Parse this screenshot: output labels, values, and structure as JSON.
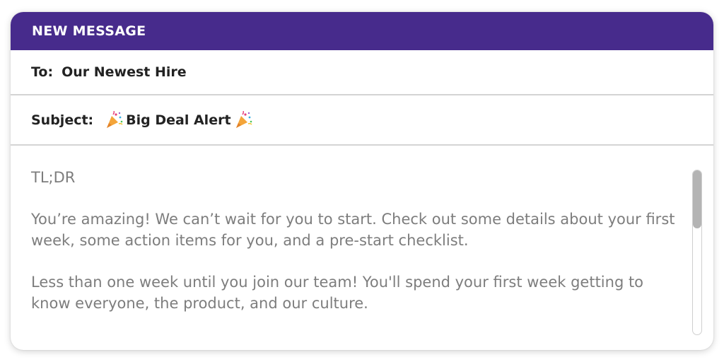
{
  "window": {
    "title": "NEW MESSAGE",
    "accent_color": "#472b8c"
  },
  "to": {
    "label": "To:",
    "value": "Our Newest Hire"
  },
  "subject": {
    "label": "Subject:",
    "emoji_left": "party-popper-icon",
    "value": "Big Deal Alert",
    "emoji_right": "party-popper-icon"
  },
  "body": {
    "paragraphs": [
      "TL;DR",
      "You’re amazing! We can’t wait for you to start. Check out some details about your first week, some action items for you, and a pre-start checklist.",
      "Less than one week until you join our team! You'll spend your first week getting to know everyone, the product, and our culture."
    ]
  }
}
